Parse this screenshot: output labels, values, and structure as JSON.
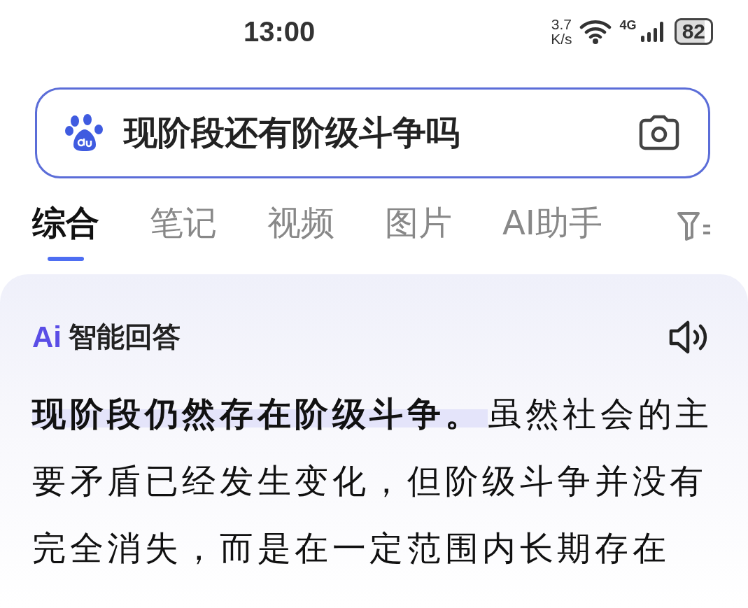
{
  "status_bar": {
    "time": "13:00",
    "speed_value": "3.7",
    "speed_unit": "K/s",
    "network": "4G",
    "battery": "82"
  },
  "search": {
    "value": "现阶段还有阶级斗争吗"
  },
  "tabs": [
    {
      "label": "综合",
      "selected": true
    },
    {
      "label": "笔记",
      "selected": false
    },
    {
      "label": "视频",
      "selected": false
    },
    {
      "label": "图片",
      "selected": false
    },
    {
      "label": "AI助手",
      "selected": false
    }
  ],
  "answer": {
    "badge": "Ai",
    "title": "智能回答",
    "highlight": "现阶段仍然存在阶级斗争。",
    "text": "虽然社会的主要矛盾已经发生变化，但阶级斗争并没有完全消失，而是在一定范围内长期存在"
  }
}
